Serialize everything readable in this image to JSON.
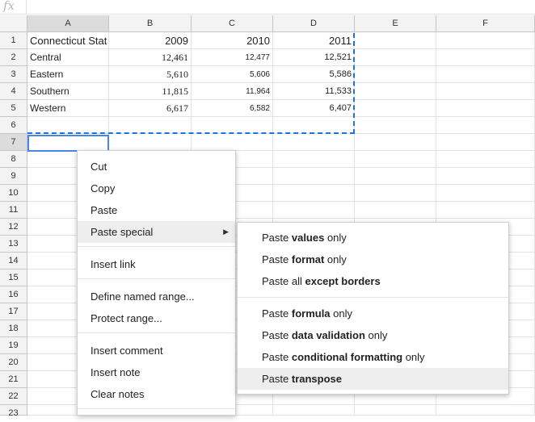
{
  "formula_bar": {
    "icon": "fx"
  },
  "columns": [
    "A",
    "B",
    "C",
    "D",
    "E",
    "F"
  ],
  "rows": [
    "1",
    "2",
    "3",
    "4",
    "5",
    "6",
    "7",
    "8",
    "9",
    "10",
    "11",
    "12",
    "13",
    "14",
    "15",
    "16",
    "17",
    "18",
    "19",
    "20",
    "21",
    "22",
    "23"
  ],
  "cells": {
    "A1": "Connecticut Stat",
    "B1": "2009",
    "C1": "2010",
    "D1": "2011",
    "A2": "Central",
    "B2": "12,461",
    "C2": "12,477",
    "D2": "12,521",
    "A3": "Eastern",
    "B3": "5,610",
    "C3": "5,606",
    "D3": "5,586",
    "A4": "Southern",
    "B4": "11,815",
    "C4": "11,964",
    "D4": "11,533",
    "A5": "Western",
    "B5": "6,617",
    "C5": "6,582",
    "D5": "6,407"
  },
  "context_menu": {
    "cut": "Cut",
    "copy": "Copy",
    "paste": "Paste",
    "paste_special": "Paste special",
    "insert_link": "Insert link",
    "define_named_range": "Define named range...",
    "protect_range": "Protect range...",
    "insert_comment": "Insert comment",
    "insert_note": "Insert note",
    "clear_notes": "Clear notes"
  },
  "paste_special_menu": [
    {
      "prefix": "Paste ",
      "bold": "values",
      "suffix": " only"
    },
    {
      "prefix": "Paste ",
      "bold": "format",
      "suffix": " only"
    },
    {
      "prefix": "Paste all ",
      "bold": "except borders",
      "suffix": ""
    },
    {
      "prefix": "Paste ",
      "bold": "formula",
      "suffix": " only"
    },
    {
      "prefix": "Paste ",
      "bold": "data validation",
      "suffix": " only"
    },
    {
      "prefix": "Paste ",
      "bold": "conditional formatting",
      "suffix": " only"
    },
    {
      "prefix": "Paste ",
      "bold": "transpose",
      "suffix": ""
    }
  ],
  "colors": {
    "selection": "#4a86e8",
    "copy_marquee": "#1a73e8",
    "menu_hover": "#eeeeee"
  }
}
